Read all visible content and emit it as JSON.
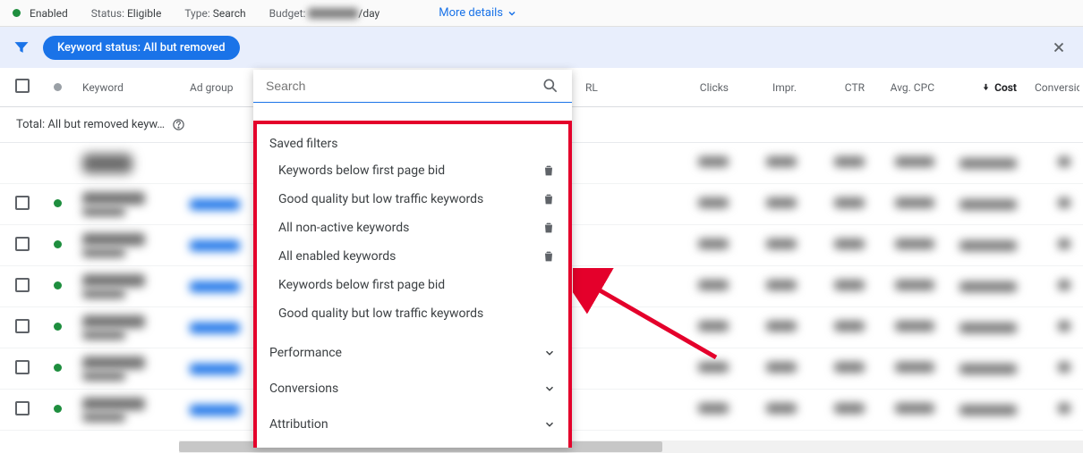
{
  "statusBar": {
    "enabled": "Enabled",
    "statusLabel": "Status:",
    "statusValue": "Eligible",
    "typeLabel": "Type:",
    "typeValue": "Search",
    "budgetLabel": "Budget:",
    "budgetSuffix": "/day",
    "moreDetails": "More details"
  },
  "filter": {
    "chip": "Keyword status: All but removed"
  },
  "columns": {
    "keyword": "Keyword",
    "adgroup": "Ad group",
    "rl": "RL",
    "clicks": "Clicks",
    "impr": "Impr.",
    "ctr": "CTR",
    "avgcpc": "Avg. CPC",
    "cost": "Cost",
    "conversions": "Conversions"
  },
  "summary": {
    "label": "Total: All but removed keyw…"
  },
  "dropdown": {
    "searchPlaceholder": "Search",
    "savedTitle": "Saved filters",
    "items": [
      {
        "label": "Keywords below first page bid",
        "deletable": true
      },
      {
        "label": "Good quality but low traffic keywords",
        "deletable": true
      },
      {
        "label": "All non-active keywords",
        "deletable": true
      },
      {
        "label": "All enabled keywords",
        "deletable": true
      },
      {
        "label": "Keywords below first page bid",
        "deletable": false
      },
      {
        "label": "Good quality but low traffic keywords",
        "deletable": false
      }
    ],
    "categories": [
      "Performance",
      "Conversions",
      "Attribution"
    ]
  },
  "rows": [
    0,
    1,
    2,
    3,
    4,
    5,
    6
  ]
}
